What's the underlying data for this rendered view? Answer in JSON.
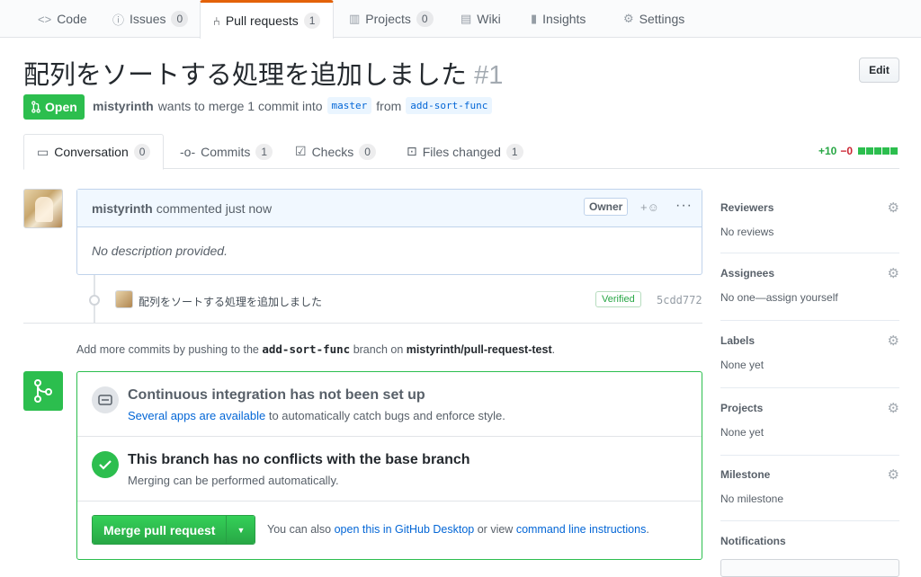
{
  "repo_tabs": [
    {
      "label": "Code",
      "icon": "code-icon"
    },
    {
      "label": "Issues",
      "icon": "issue-icon",
      "count": "0"
    },
    {
      "label": "Pull requests",
      "icon": "pull-request-icon",
      "count": "1"
    },
    {
      "label": "Projects",
      "icon": "project-icon",
      "count": "0"
    },
    {
      "label": "Wiki",
      "icon": "book-icon"
    },
    {
      "label": "Insights",
      "icon": "graph-icon"
    },
    {
      "label": "Settings",
      "icon": "gear-icon"
    }
  ],
  "pr": {
    "title": "配列をソートする処理を追加しました",
    "number": "#1",
    "edit_label": "Edit",
    "state": "Open",
    "author": "mistyrinth",
    "meta_text": "wants to merge 1 commit into",
    "base_branch": "master",
    "from_text": "from",
    "head_branch": "add-sort-func"
  },
  "pr_tabs": [
    {
      "label": "Conversation",
      "count": "0"
    },
    {
      "label": "Commits",
      "count": "1"
    },
    {
      "label": "Checks",
      "count": "0"
    },
    {
      "label": "Files changed",
      "count": "1"
    }
  ],
  "diffstat": {
    "additions": "+10",
    "deletions": "−0"
  },
  "comment": {
    "author": "mistyrinth",
    "action": "commented just now",
    "badge": "Owner",
    "body": "No description provided."
  },
  "commit": {
    "message": "配列をソートする処理を追加しました",
    "verified": "Verified",
    "sha": "5cdd772"
  },
  "push_note": {
    "prefix": "Add more commits by pushing to the",
    "branch": "add-sort-func",
    "middle": "branch on",
    "repo": "mistyrinth/pull-request-test",
    "suffix": "."
  },
  "merge": {
    "ci_title": "Continuous integration has not been set up",
    "ci_link": "Several apps are available",
    "ci_rest": "to automatically catch bugs and enforce style.",
    "conflict_title": "This branch has no conflicts with the base branch",
    "conflict_sub": "Merging can be performed automatically.",
    "button": "Merge pull request",
    "alt_prefix": "You can also",
    "alt_link1": "open this in GitHub Desktop",
    "alt_middle": "or view",
    "alt_link2": "command line instructions",
    "alt_suffix": "."
  },
  "sidebar": [
    {
      "heading": "Reviewers",
      "value": "No reviews"
    },
    {
      "heading": "Assignees",
      "value": "No one—assign yourself"
    },
    {
      "heading": "Labels",
      "value": "None yet"
    },
    {
      "heading": "Projects",
      "value": "None yet"
    },
    {
      "heading": "Milestone",
      "value": "No milestone"
    },
    {
      "heading": "Notifications",
      "value": ""
    }
  ],
  "colors": {
    "accent_orange": "#e36209",
    "green": "#2cbe4e",
    "link_blue": "#0366d6"
  }
}
